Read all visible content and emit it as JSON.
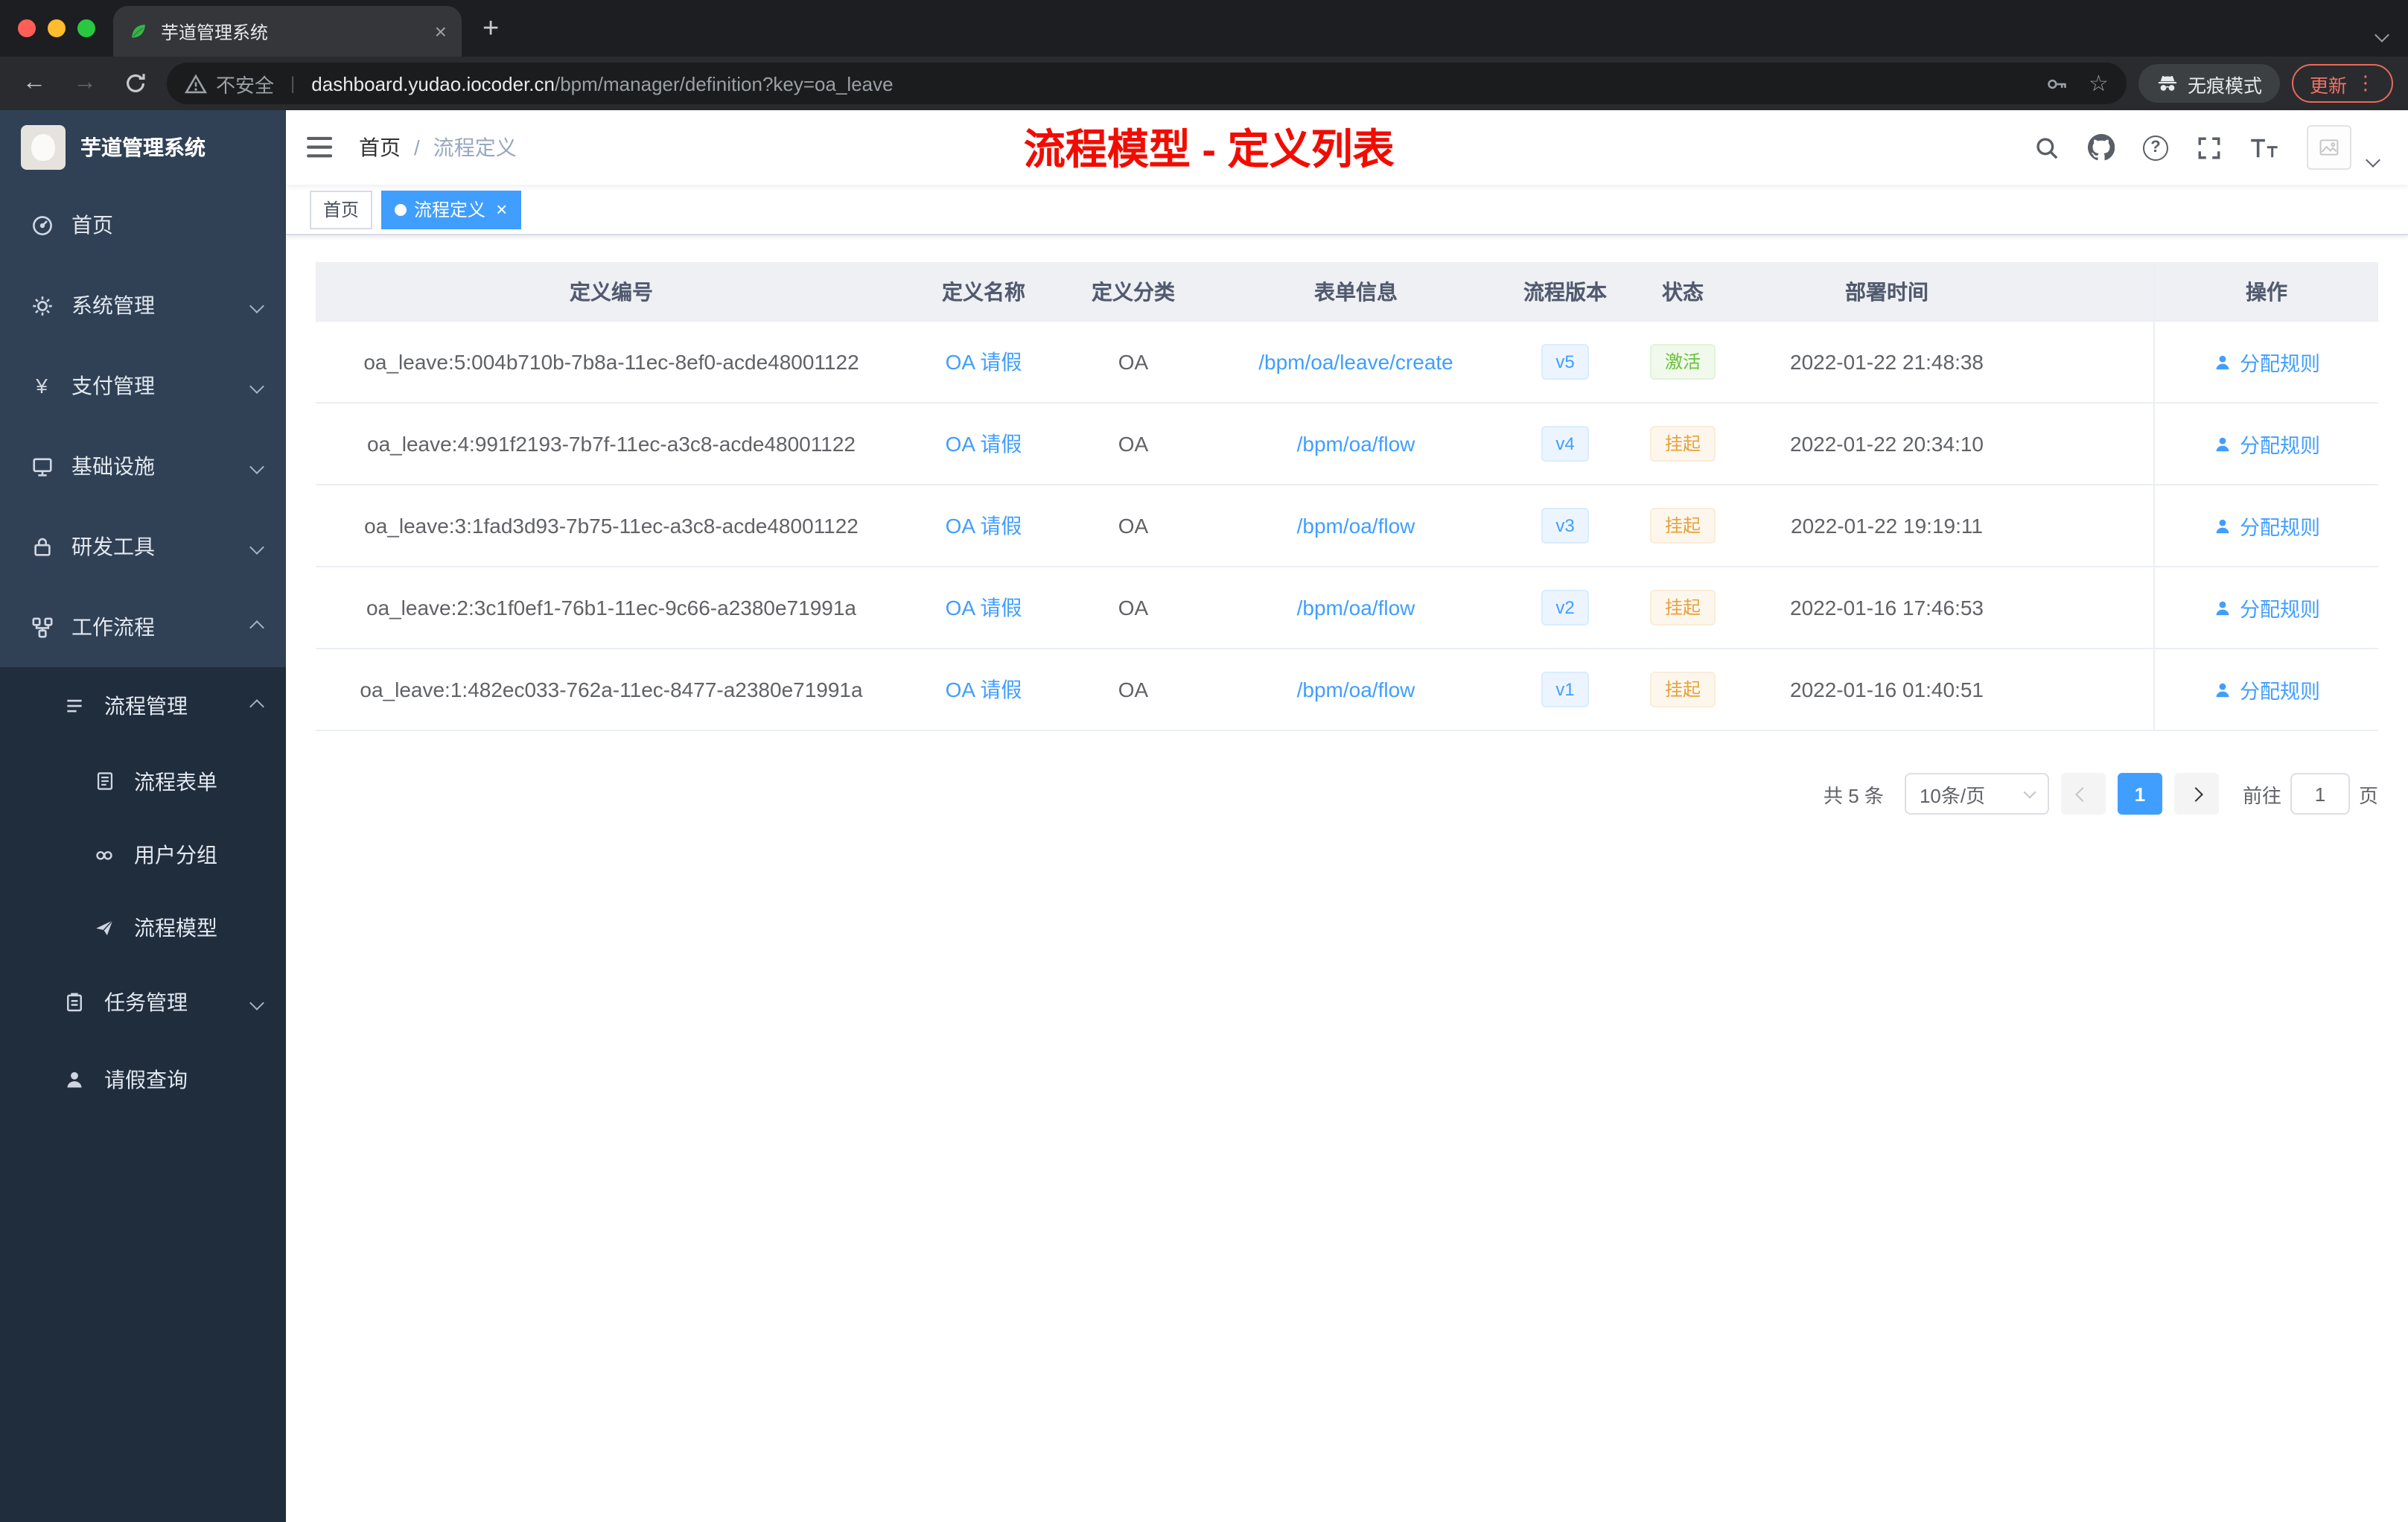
{
  "colors": {
    "accent_blue": "#409eff",
    "annotation_red": "#f20c00",
    "success_green": "#67c23a",
    "warning_orange": "#e6a23c",
    "sidebar_bg": "#304156",
    "submenu_bg": "#1f2d3d",
    "active_tag_bg": "#409eff"
  },
  "browser": {
    "tab_title": "芋道管理系统",
    "security_warning": "不安全",
    "url_host": "dashboard.yudao.iocoder.cn",
    "url_path": "/bpm/manager/definition?key=oa_leave",
    "incognito_label": "无痕模式",
    "update_label": "更新",
    "icons": [
      "site-favicon-icon",
      "close-icon",
      "plus-icon",
      "tab-search-icon",
      "back-arrow-icon",
      "forward-arrow-icon",
      "reload-icon",
      "warning-triangle-icon",
      "key-icon",
      "star-icon",
      "incognito-icon",
      "kebab-menu-icon"
    ]
  },
  "sidebar": {
    "logo_title": "芋道管理系统",
    "items": [
      {
        "label": "首页",
        "icon": "dashboard-icon"
      },
      {
        "label": "系统管理",
        "icon": "gear-icon",
        "state": "collapsed"
      },
      {
        "label": "支付管理",
        "icon": "payment-icon",
        "state": "collapsed"
      },
      {
        "label": "基础设施",
        "icon": "infrastructure-icon",
        "state": "collapsed"
      },
      {
        "label": "研发工具",
        "icon": "devtools-icon",
        "state": "collapsed"
      },
      {
        "label": "工作流程",
        "icon": "workflow-icon",
        "state": "expanded",
        "children": [
          {
            "label": "流程管理",
            "icon": "process-management-icon",
            "state": "expanded",
            "children": [
              {
                "label": "流程表单",
                "icon": "form-icon"
              },
              {
                "label": "用户分组",
                "icon": "user-group-icon"
              },
              {
                "label": "流程模型",
                "icon": "paper-plane-icon"
              }
            ]
          },
          {
            "label": "任务管理",
            "icon": "task-icon",
            "state": "collapsed"
          },
          {
            "label": "请假查询",
            "icon": "person-icon"
          }
        ]
      }
    ]
  },
  "header": {
    "breadcrumb": [
      "首页",
      "流程定义"
    ],
    "breadcrumb_separator": "/",
    "annotation": "流程模型 - 定义列表",
    "right_icons": [
      "search-icon",
      "github-icon",
      "help-icon",
      "fullscreen-icon",
      "font-size-icon",
      "user-avatar",
      "chevron-down-icon"
    ]
  },
  "tags_bar": [
    {
      "label": "首页",
      "active": false
    },
    {
      "label": "流程定义",
      "active": true
    }
  ],
  "table": {
    "columns": [
      "定义编号",
      "定义名称",
      "定义分类",
      "表单信息",
      "流程版本",
      "状态",
      "部署时间",
      "操作"
    ],
    "rows": [
      {
        "id": "oa_leave:5:004b710b-7b8a-11ec-8ef0-acde48001122",
        "name": "OA 请假",
        "category": "OA",
        "form": "/bpm/oa/leave/create",
        "version": "v5",
        "status": "激活",
        "status_type": "success",
        "deployed_at": "2022-01-22 21:48:38",
        "action": "分配规则"
      },
      {
        "id": "oa_leave:4:991f2193-7b7f-11ec-a3c8-acde48001122",
        "name": "OA 请假",
        "category": "OA",
        "form": "/bpm/oa/flow",
        "version": "v4",
        "status": "挂起",
        "status_type": "warning",
        "deployed_at": "2022-01-22 20:34:10",
        "action": "分配规则"
      },
      {
        "id": "oa_leave:3:1fad3d93-7b75-11ec-a3c8-acde48001122",
        "name": "OA 请假",
        "category": "OA",
        "form": "/bpm/oa/flow",
        "version": "v3",
        "status": "挂起",
        "status_type": "warning",
        "deployed_at": "2022-01-22 19:19:11",
        "action": "分配规则"
      },
      {
        "id": "oa_leave:2:3c1f0ef1-76b1-11ec-9c66-a2380e71991a",
        "name": "OA 请假",
        "category": "OA",
        "form": "/bpm/oa/flow",
        "version": "v2",
        "status": "挂起",
        "status_type": "warning",
        "deployed_at": "2022-01-16 17:46:53",
        "action": "分配规则"
      },
      {
        "id": "oa_leave:1:482ec033-762a-11ec-8477-a2380e71991a",
        "name": "OA 请假",
        "category": "OA",
        "form": "/bpm/oa/flow",
        "version": "v1",
        "status": "挂起",
        "status_type": "warning",
        "deployed_at": "2022-01-16 01:40:51",
        "action": "分配规则"
      }
    ]
  },
  "pagination": {
    "total": "共 5 条",
    "page_size": "10条/页",
    "current_page": "1",
    "goto_prefix": "前往",
    "goto_value": "1",
    "goto_suffix": "页"
  }
}
